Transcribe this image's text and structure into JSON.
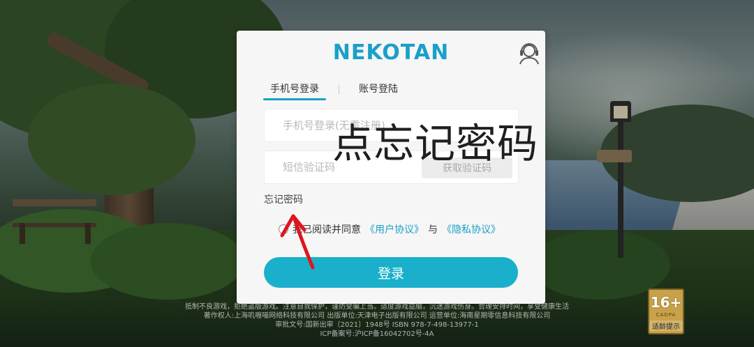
{
  "brand": {
    "logo_text": "NEKOTAN",
    "accent": "#1aa0c9"
  },
  "login": {
    "tabs": [
      {
        "label": "手机号登录",
        "active": true
      },
      {
        "label": "账号登陆",
        "active": false
      }
    ],
    "phone_placeholder": "手机号登录(无需注册)",
    "sms_placeholder": "短信验证码",
    "sms_button": "获取验证码",
    "forgot_password": "忘记密码",
    "agree_text": "我已阅读并同意",
    "user_agreement": "《用户协议》",
    "and_text": "与",
    "privacy_policy": "《隐私协议》",
    "login_button": "登录",
    "button_color": "#1ab0cc"
  },
  "annotation": {
    "text": "点忘记密码"
  },
  "footer": {
    "line1": "抵制不良游戏，拒绝盗版游戏。注意自我保护，谨防受骗上当。适度游戏益脑，沉迷游戏伤身。合理安排时间，享受健康生活",
    "line2": "著作权人:上海叽喱喵网络科技有限公司 出版单位:天津电子出版有限公司 运营单位:海南星期零信息科技有限公司",
    "line3": "审批文号:国新出审〔2021〕1948号 ISBN 978-7-498-13977-1",
    "line4": "ICP备案号:沪ICP备16042702号-4A"
  },
  "rating": {
    "age": "16+",
    "org": "CADPA",
    "tip": "适龄提示"
  }
}
